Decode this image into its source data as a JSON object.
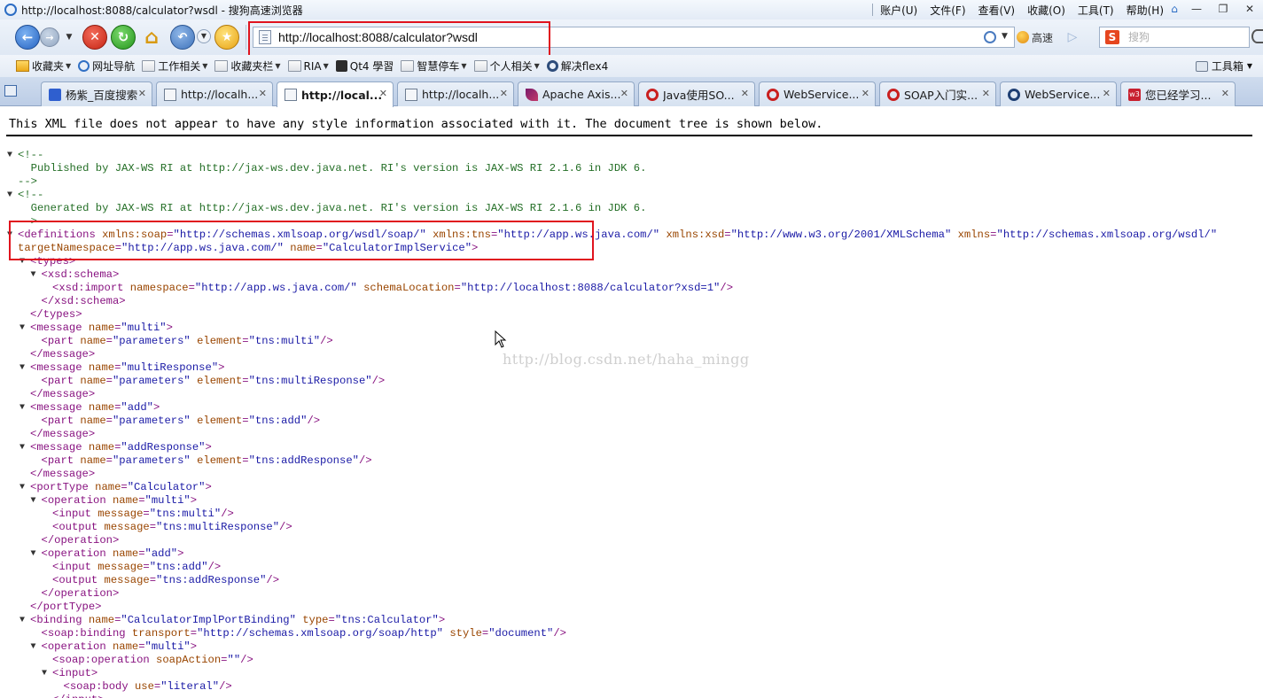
{
  "window": {
    "title": "http://localhost:8088/calculator?wsdl - 搜狗高速浏览器",
    "menus": [
      "账户(U)",
      "文件(F)",
      "查看(V)",
      "收藏(O)",
      "工具(T)",
      "帮助(H)"
    ]
  },
  "nav": {
    "url": "http://localhost:8088/calculator?wsdl",
    "speed_label": "高速",
    "search_placeholder": "搜狗"
  },
  "bookmarks": {
    "items": [
      {
        "label": "收藏夹",
        "icon": "star-folder-icon",
        "dropdown": true
      },
      {
        "label": "网址导航",
        "icon": "globe-icon",
        "dropdown": false
      },
      {
        "label": "工作相关",
        "icon": "folder-icon",
        "dropdown": true
      },
      {
        "label": "收藏夹栏",
        "icon": "folder-icon",
        "dropdown": true
      },
      {
        "label": "RIA",
        "icon": "folder-icon",
        "dropdown": true
      },
      {
        "label": "Qt4 學習",
        "icon": "qt-icon",
        "dropdown": false
      },
      {
        "label": "智慧停车",
        "icon": "folder-icon",
        "dropdown": true
      },
      {
        "label": "个人相关",
        "icon": "folder-icon",
        "dropdown": true
      },
      {
        "label": "解决flex4",
        "icon": "flex-icon",
        "dropdown": false
      }
    ],
    "toolbox_label": "工具箱"
  },
  "tabs": [
    {
      "label": "杨紫_百度搜索",
      "icon": "baidu-icon",
      "active": false
    },
    {
      "label": "http://localh...",
      "icon": "page-icon",
      "active": false
    },
    {
      "label": "http://local...",
      "icon": "page-icon",
      "active": true
    },
    {
      "label": "http://localh...",
      "icon": "page-icon",
      "active": false
    },
    {
      "label": "Apache Axis...",
      "icon": "feather-icon",
      "active": false
    },
    {
      "label": "Java使用SO...",
      "icon": "csdn-icon",
      "active": false
    },
    {
      "label": "WebService...",
      "icon": "csdn-icon",
      "active": false
    },
    {
      "label": "SOAP入门实...",
      "icon": "csdn-icon",
      "active": false
    },
    {
      "label": "WebService...",
      "icon": "qt-icon",
      "active": false
    },
    {
      "label": "您已经学习...",
      "icon": "w3-icon",
      "active": false
    }
  ],
  "content": {
    "notice": "This XML file does not appear to have any style information associated with it. The document tree is shown below.",
    "watermark": "http://blog.csdn.net/haha_mingg",
    "comment1": {
      "open": "<!--",
      "body": "  Published by JAX-WS RI at http://jax-ws.dev.java.net. RI's version is JAX-WS RI 2.1.6 in JDK 6.",
      "close": "-->"
    },
    "comment2": {
      "open": "<!--",
      "body": "  Generated by JAX-WS RI at http://jax-ws.dev.java.net. RI's version is JAX-WS RI 2.1.6 in JDK 6.",
      "close": "-->"
    },
    "definitions": {
      "line1": "<definitions xmlns:soap=\"http://schemas.xmlsoap.org/wsdl/soap/\" xmlns:tns=\"http://app.ws.java.com/\" xmlns:xsd=\"http://www.w3.org/2001/XMLSchema\" xmlns=\"http://schemas.xmlsoap.org/wsdl/\"",
      "line2": "targetNamespace=\"http://app.ws.java.com/\" name=\"CalculatorImplService\">"
    },
    "lines": [
      {
        "indent": 1,
        "tri": true,
        "text": "<types>"
      },
      {
        "indent": 2,
        "tri": true,
        "text": "<xsd:schema>"
      },
      {
        "indent": 3,
        "tri": false,
        "text": "<xsd:import namespace=\"http://app.ws.java.com/\" schemaLocation=\"http://localhost:8088/calculator?xsd=1\"/>"
      },
      {
        "indent": 2,
        "tri": false,
        "text": "</xsd:schema>"
      },
      {
        "indent": 1,
        "tri": false,
        "text": "</types>"
      },
      {
        "indent": 1,
        "tri": true,
        "text": "<message name=\"multi\">"
      },
      {
        "indent": 2,
        "tri": false,
        "text": "<part name=\"parameters\" element=\"tns:multi\"/>"
      },
      {
        "indent": 1,
        "tri": false,
        "text": "</message>"
      },
      {
        "indent": 1,
        "tri": true,
        "text": "<message name=\"multiResponse\">"
      },
      {
        "indent": 2,
        "tri": false,
        "text": "<part name=\"parameters\" element=\"tns:multiResponse\"/>"
      },
      {
        "indent": 1,
        "tri": false,
        "text": "</message>"
      },
      {
        "indent": 1,
        "tri": true,
        "text": "<message name=\"add\">"
      },
      {
        "indent": 2,
        "tri": false,
        "text": "<part name=\"parameters\" element=\"tns:add\"/>"
      },
      {
        "indent": 1,
        "tri": false,
        "text": "</message>"
      },
      {
        "indent": 1,
        "tri": true,
        "text": "<message name=\"addResponse\">"
      },
      {
        "indent": 2,
        "tri": false,
        "text": "<part name=\"parameters\" element=\"tns:addResponse\"/>"
      },
      {
        "indent": 1,
        "tri": false,
        "text": "</message>"
      },
      {
        "indent": 1,
        "tri": true,
        "text": "<portType name=\"Calculator\">"
      },
      {
        "indent": 2,
        "tri": true,
        "text": "<operation name=\"multi\">"
      },
      {
        "indent": 3,
        "tri": false,
        "text": "<input message=\"tns:multi\"/>"
      },
      {
        "indent": 3,
        "tri": false,
        "text": "<output message=\"tns:multiResponse\"/>"
      },
      {
        "indent": 2,
        "tri": false,
        "text": "</operation>"
      },
      {
        "indent": 2,
        "tri": true,
        "text": "<operation name=\"add\">"
      },
      {
        "indent": 3,
        "tri": false,
        "text": "<input message=\"tns:add\"/>"
      },
      {
        "indent": 3,
        "tri": false,
        "text": "<output message=\"tns:addResponse\"/>"
      },
      {
        "indent": 2,
        "tri": false,
        "text": "</operation>"
      },
      {
        "indent": 1,
        "tri": false,
        "text": "</portType>"
      },
      {
        "indent": 1,
        "tri": true,
        "text": "<binding name=\"CalculatorImplPortBinding\" type=\"tns:Calculator\">"
      },
      {
        "indent": 2,
        "tri": false,
        "text": "<soap:binding transport=\"http://schemas.xmlsoap.org/soap/http\" style=\"document\"/>"
      },
      {
        "indent": 2,
        "tri": true,
        "text": "<operation name=\"multi\">"
      },
      {
        "indent": 3,
        "tri": false,
        "text": "<soap:operation soapAction=\"\"/>"
      },
      {
        "indent": 3,
        "tri": true,
        "text": "<input>"
      },
      {
        "indent": 4,
        "tri": false,
        "text": "<soap:body use=\"literal\"/>"
      },
      {
        "indent": 3,
        "tri": false,
        "text": "</input>"
      }
    ]
  }
}
